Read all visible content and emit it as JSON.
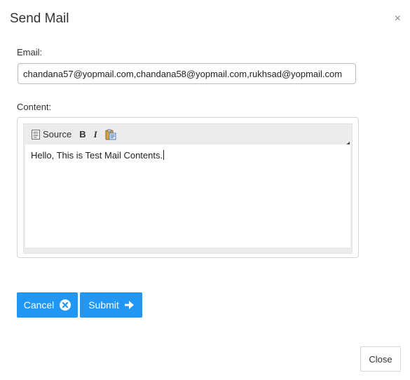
{
  "dialog": {
    "title": "Send Mail",
    "close_glyph": "×"
  },
  "email": {
    "label": "Email:",
    "value": "chandana57@yopmail.com,chandana58@yopmail.com,rukhsad@yopmail.com"
  },
  "content": {
    "label": "Content:",
    "toolbar": {
      "source_label": "Source",
      "bold_glyph": "B",
      "italic_glyph": "I",
      "icons": [
        "source-icon",
        "bold-icon",
        "italic-icon",
        "paste-icon",
        "resize-icon"
      ]
    },
    "body_text": "Hello, This is Test Mail Contents."
  },
  "buttons": {
    "cancel_label": "Cancel",
    "submit_label": "Submit",
    "close_label": "Close"
  },
  "colors": {
    "primary": "#2196f3",
    "text": "#333333",
    "border": "#d4d4d4"
  }
}
